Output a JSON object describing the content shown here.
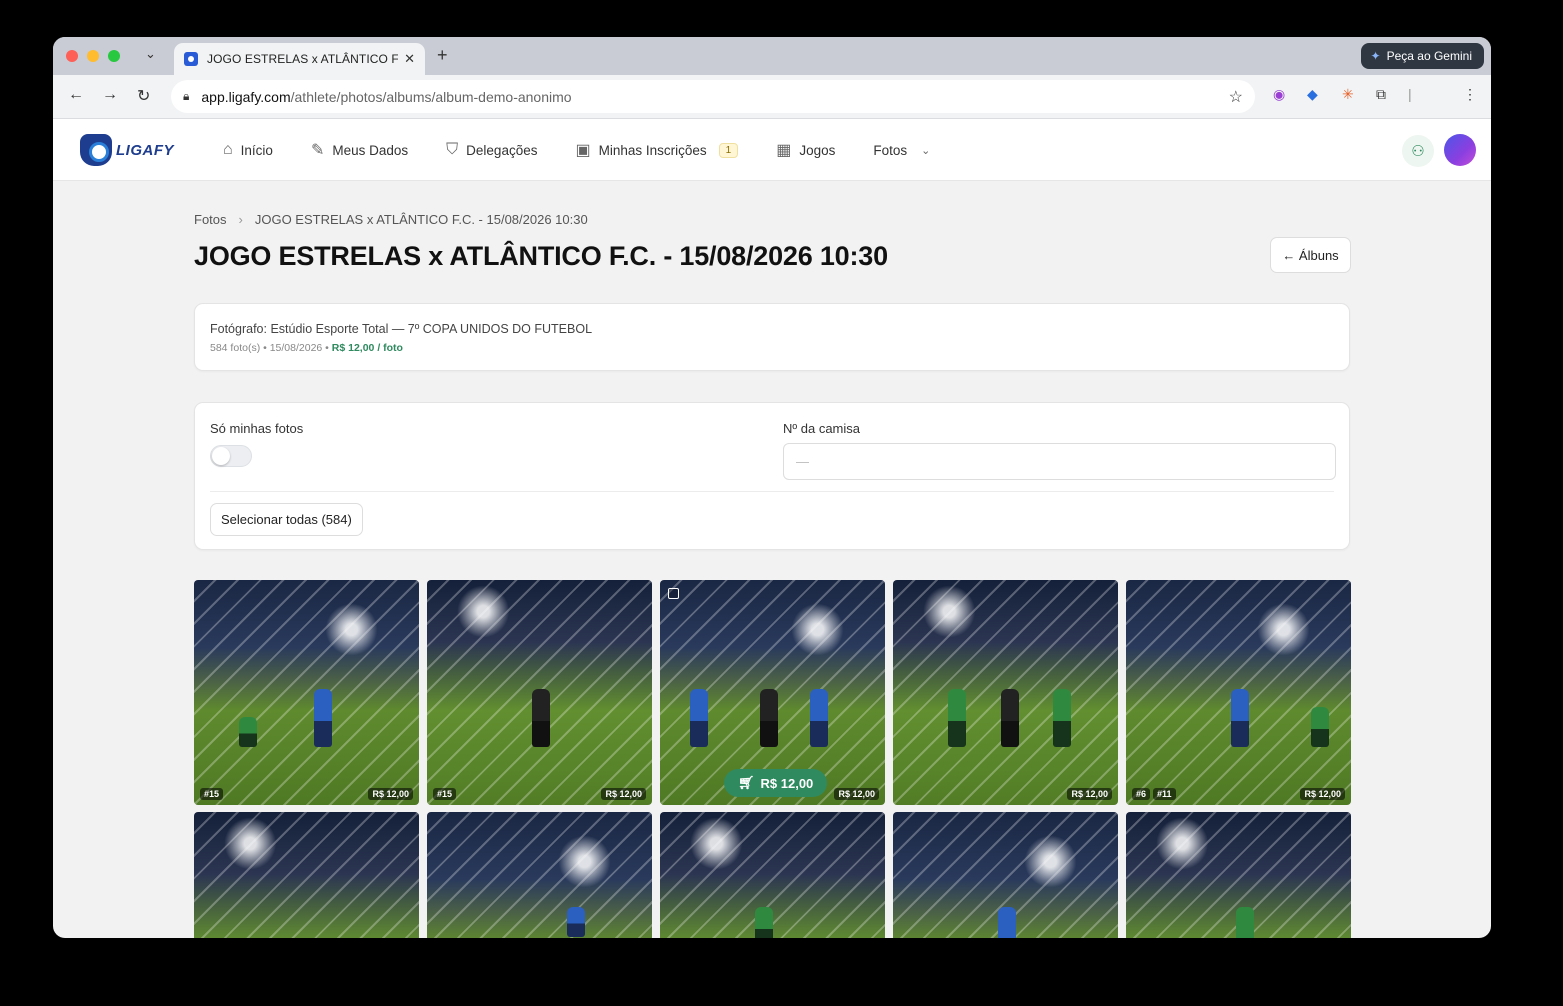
{
  "browser": {
    "tab_title": "JOGO ESTRELAS x ATLÂNTICO F.C.",
    "url_host": "app.ligafy.com",
    "url_path": "/athlete/photos/albums/album-demo-anonimo",
    "gemini_label": "Peça ao Gemini"
  },
  "header": {
    "logo_text": "LIGAFY",
    "nav": [
      {
        "label": "Início",
        "icon": "home-icon"
      },
      {
        "label": "Meus Dados",
        "icon": "edit-icon"
      },
      {
        "label": "Delegações",
        "icon": "shield-icon"
      },
      {
        "label": "Minhas Inscrições",
        "icon": "clipboard-icon",
        "badge": "1"
      },
      {
        "label": "Jogos",
        "icon": "calendar-icon"
      },
      {
        "label": "Fotos",
        "icon": "chevron-down-icon"
      }
    ]
  },
  "page": {
    "breadcrumb_root": "Fotos",
    "breadcrumb_current": "JOGO ESTRELAS x ATLÂNTICO F.C. - 15/08/2026 10:30",
    "title": "JOGO ESTRELAS x ATLÂNTICO F.C. - 15/08/2026 10:30",
    "back_label": "← Álbuns"
  },
  "album_info": {
    "photographer": "Fotógrafo: Estúdio Esporte Total — 7º COPA UNIDOS DO FUTEBOL",
    "meta": "584 foto(s) • 15/08/2026 •",
    "price": "R$ 12,00 / foto"
  },
  "filters": {
    "only_mine_label": "Só minhas fotos",
    "only_mine_on": false,
    "shirt_label": "Nº da camisa",
    "shirt_placeholder": "—",
    "select_all_label": "Selecionar todas (584)"
  },
  "photos": [
    {
      "tags": [
        "#15"
      ],
      "price": "R$ 12,00"
    },
    {
      "tags": [
        "#15"
      ],
      "price": "R$ 12,00"
    },
    {
      "tags": [],
      "price": "R$ 12,00",
      "cart_label": "R$ 12,00",
      "hover": true
    },
    {
      "tags": [],
      "price": "R$ 12,00"
    },
    {
      "tags": [
        "#6",
        "#11"
      ],
      "price": "R$ 12,00"
    },
    {
      "tags": [],
      "price": ""
    },
    {
      "tags": [],
      "price": ""
    },
    {
      "tags": [],
      "price": ""
    },
    {
      "tags": [],
      "price": ""
    },
    {
      "tags": [],
      "price": ""
    }
  ],
  "colors": {
    "accent_green": "#2f8a5f",
    "brand_blue": "#1e3d8f"
  }
}
